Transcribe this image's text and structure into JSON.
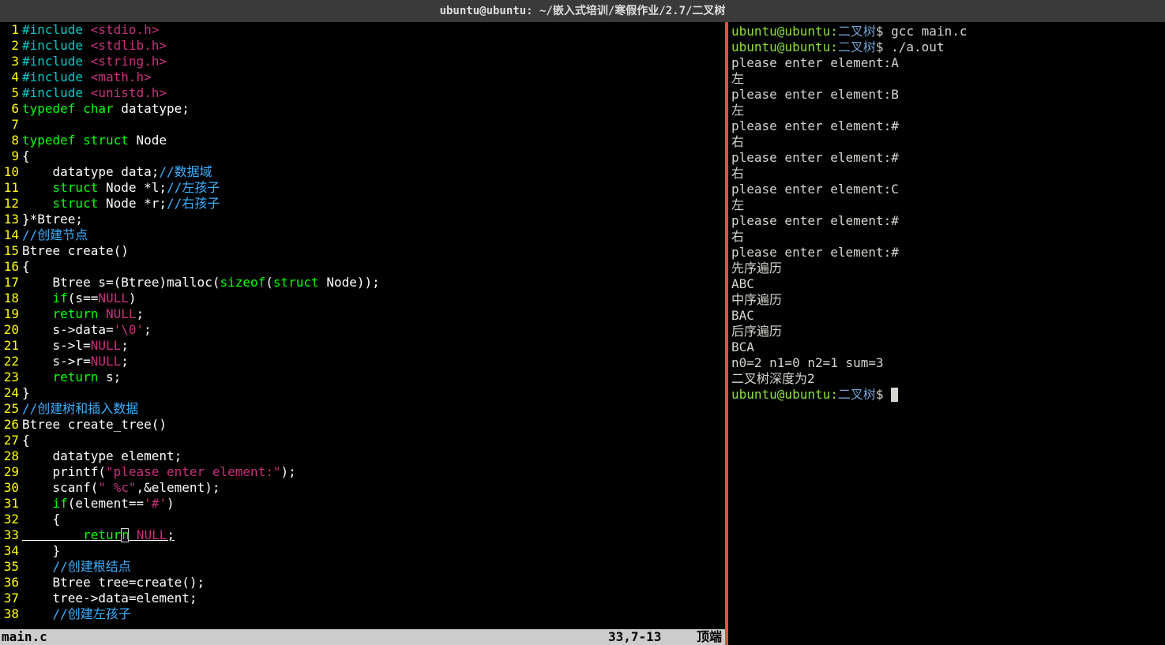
{
  "titlebar": "ubuntu@ubuntu: ~/嵌入式培训/寒假作业/2.7/二叉树",
  "editor": {
    "lines": [
      {
        "n": 1,
        "tokens": [
          {
            "t": "#include",
            "c": "inc"
          },
          {
            "t": " "
          },
          {
            "t": "<stdio.h>",
            "c": "str"
          }
        ]
      },
      {
        "n": 2,
        "tokens": [
          {
            "t": "#include",
            "c": "inc"
          },
          {
            "t": " "
          },
          {
            "t": "<stdlib.h>",
            "c": "str"
          }
        ]
      },
      {
        "n": 3,
        "tokens": [
          {
            "t": "#include",
            "c": "inc"
          },
          {
            "t": " "
          },
          {
            "t": "<string.h>",
            "c": "str"
          }
        ]
      },
      {
        "n": 4,
        "tokens": [
          {
            "t": "#include",
            "c": "inc"
          },
          {
            "t": " "
          },
          {
            "t": "<math.h>",
            "c": "str"
          }
        ]
      },
      {
        "n": 5,
        "tokens": [
          {
            "t": "#include",
            "c": "inc"
          },
          {
            "t": " "
          },
          {
            "t": "<unistd.h>",
            "c": "str"
          }
        ]
      },
      {
        "n": 6,
        "tokens": [
          {
            "t": "typedef",
            "c": "kw"
          },
          {
            "t": " "
          },
          {
            "t": "char",
            "c": "type"
          },
          {
            "t": " datatype;"
          }
        ]
      },
      {
        "n": 7,
        "tokens": []
      },
      {
        "n": 8,
        "tokens": [
          {
            "t": "typedef",
            "c": "kw"
          },
          {
            "t": " "
          },
          {
            "t": "struct",
            "c": "kw"
          },
          {
            "t": " Node"
          }
        ]
      },
      {
        "n": 9,
        "tokens": [
          {
            "t": "{"
          }
        ]
      },
      {
        "n": 10,
        "tokens": [
          {
            "t": "    datatype data;"
          },
          {
            "t": "//数据域",
            "c": "cmt"
          }
        ]
      },
      {
        "n": 11,
        "tokens": [
          {
            "t": "    "
          },
          {
            "t": "struct",
            "c": "kw"
          },
          {
            "t": " Node *l;"
          },
          {
            "t": "//左孩子",
            "c": "cmt"
          }
        ]
      },
      {
        "n": 12,
        "tokens": [
          {
            "t": "    "
          },
          {
            "t": "struct",
            "c": "kw"
          },
          {
            "t": " Node *r;"
          },
          {
            "t": "//右孩子",
            "c": "cmt"
          }
        ]
      },
      {
        "n": 13,
        "tokens": [
          {
            "t": "}*Btree;"
          }
        ]
      },
      {
        "n": 14,
        "tokens": [
          {
            "t": "//创建节点",
            "c": "cmt"
          }
        ]
      },
      {
        "n": 15,
        "tokens": [
          {
            "t": "Btree create()"
          }
        ]
      },
      {
        "n": 16,
        "tokens": [
          {
            "t": "{"
          }
        ]
      },
      {
        "n": 17,
        "tokens": [
          {
            "t": "    Btree s=(Btree)malloc("
          },
          {
            "t": "sizeof",
            "c": "kw"
          },
          {
            "t": "("
          },
          {
            "t": "struct",
            "c": "kw"
          },
          {
            "t": " Node));"
          }
        ]
      },
      {
        "n": 18,
        "tokens": [
          {
            "t": "    "
          },
          {
            "t": "if",
            "c": "kw"
          },
          {
            "t": "(s=="
          },
          {
            "t": "NULL",
            "c": "const"
          },
          {
            "t": ")"
          }
        ]
      },
      {
        "n": 19,
        "tokens": [
          {
            "t": "    "
          },
          {
            "t": "return",
            "c": "kw"
          },
          {
            "t": " "
          },
          {
            "t": "NULL",
            "c": "const"
          },
          {
            "t": ";"
          }
        ]
      },
      {
        "n": 20,
        "tokens": [
          {
            "t": "    s->data="
          },
          {
            "t": "'\\0'",
            "c": "char"
          },
          {
            "t": ";"
          }
        ]
      },
      {
        "n": 21,
        "tokens": [
          {
            "t": "    s->l="
          },
          {
            "t": "NULL",
            "c": "const"
          },
          {
            "t": ";"
          }
        ]
      },
      {
        "n": 22,
        "tokens": [
          {
            "t": "    s->r="
          },
          {
            "t": "NULL",
            "c": "const"
          },
          {
            "t": ";"
          }
        ]
      },
      {
        "n": 23,
        "tokens": [
          {
            "t": "    "
          },
          {
            "t": "return",
            "c": "kw"
          },
          {
            "t": " s;"
          }
        ]
      },
      {
        "n": 24,
        "tokens": [
          {
            "t": "}"
          }
        ]
      },
      {
        "n": 25,
        "tokens": [
          {
            "t": "//创建树和插入数据",
            "c": "cmt"
          }
        ]
      },
      {
        "n": 26,
        "tokens": [
          {
            "t": "Btree create_tree()"
          }
        ]
      },
      {
        "n": 27,
        "tokens": [
          {
            "t": "{"
          }
        ]
      },
      {
        "n": 28,
        "tokens": [
          {
            "t": "    datatype element;"
          }
        ]
      },
      {
        "n": 29,
        "tokens": [
          {
            "t": "    printf("
          },
          {
            "t": "\"please enter element:\"",
            "c": "str"
          },
          {
            "t": ");"
          }
        ]
      },
      {
        "n": 30,
        "tokens": [
          {
            "t": "    scanf("
          },
          {
            "t": "\" %c\"",
            "c": "str"
          },
          {
            "t": ",&element);"
          }
        ]
      },
      {
        "n": 31,
        "tokens": [
          {
            "t": "    "
          },
          {
            "t": "if",
            "c": "kw"
          },
          {
            "t": "(element=="
          },
          {
            "t": "'#'",
            "c": "char"
          },
          {
            "t": ")"
          }
        ]
      },
      {
        "n": 32,
        "tokens": [
          {
            "t": "    {"
          }
        ]
      },
      {
        "n": 33,
        "tokens": [
          {
            "t": "        "
          },
          {
            "t": "retur",
            "c": "kw"
          },
          {
            "t": "n",
            "c": "kw",
            "cursor": true
          },
          {
            "t": " "
          },
          {
            "t": "NULL",
            "c": "const"
          },
          {
            "t": ";"
          }
        ],
        "current": true
      },
      {
        "n": 34,
        "tokens": [
          {
            "t": "    }"
          }
        ]
      },
      {
        "n": 35,
        "tokens": [
          {
            "t": "    "
          },
          {
            "t": "//创建根结点",
            "c": "cmt"
          }
        ]
      },
      {
        "n": 36,
        "tokens": [
          {
            "t": "    Btree tree=create();"
          }
        ]
      },
      {
        "n": 37,
        "tokens": [
          {
            "t": "    tree->data=element;"
          }
        ]
      },
      {
        "n": 38,
        "tokens": [
          {
            "t": "    "
          },
          {
            "t": "//创建左孩子",
            "c": "cmt"
          }
        ]
      }
    ],
    "status": {
      "filename": "main.c",
      "position": "33,7-13",
      "scroll": "顶端"
    }
  },
  "terminal": {
    "prompt_user": "ubuntu@ubuntu",
    "prompt_path": "二叉树",
    "lines": [
      {
        "type": "cmd",
        "cmd": "gcc main.c"
      },
      {
        "type": "cmd",
        "cmd": "./a.out"
      },
      {
        "type": "out",
        "text": "please enter element:A"
      },
      {
        "type": "out",
        "text": "左"
      },
      {
        "type": "out",
        "text": "please enter element:B"
      },
      {
        "type": "out",
        "text": "左"
      },
      {
        "type": "out",
        "text": "please enter element:#"
      },
      {
        "type": "out",
        "text": "右"
      },
      {
        "type": "out",
        "text": "please enter element:#"
      },
      {
        "type": "out",
        "text": "右"
      },
      {
        "type": "out",
        "text": "please enter element:C"
      },
      {
        "type": "out",
        "text": "左"
      },
      {
        "type": "out",
        "text": "please enter element:#"
      },
      {
        "type": "out",
        "text": "右"
      },
      {
        "type": "out",
        "text": "please enter element:#"
      },
      {
        "type": "out",
        "text": "先序遍历"
      },
      {
        "type": "out",
        "text": "ABC"
      },
      {
        "type": "out",
        "text": "中序遍历"
      },
      {
        "type": "out",
        "text": "BAC"
      },
      {
        "type": "out",
        "text": "后序遍历"
      },
      {
        "type": "out",
        "text": "BCA"
      },
      {
        "type": "out",
        "text": "n0=2 n1=0 n2=1 sum=3"
      },
      {
        "type": "out",
        "text": "二叉树深度为2"
      },
      {
        "type": "prompt"
      }
    ]
  }
}
